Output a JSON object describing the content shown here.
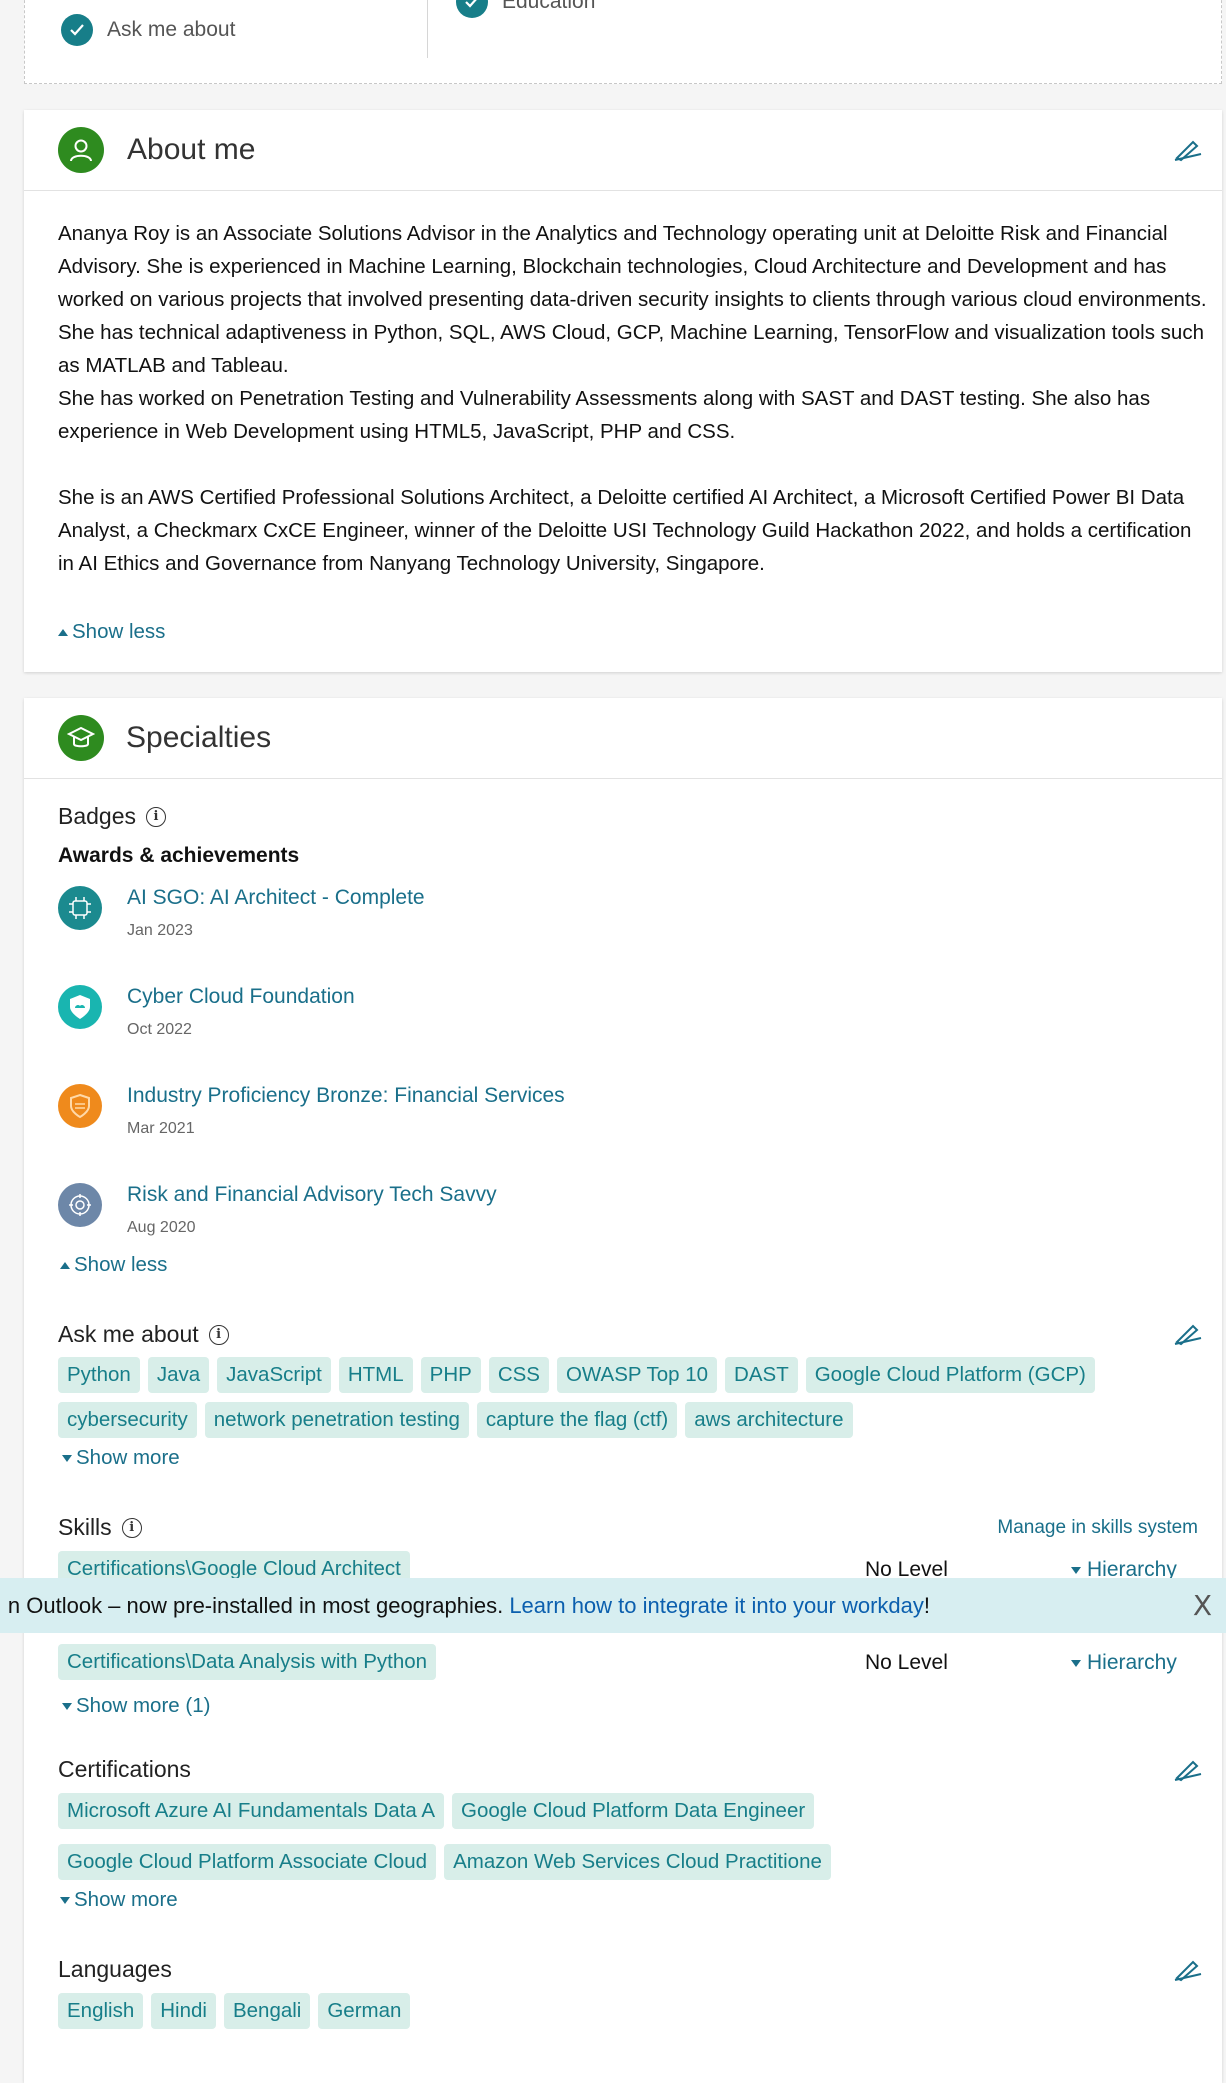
{
  "top_checks": {
    "item1": "Ask me about",
    "item2": "Education"
  },
  "about": {
    "title": "About me",
    "paragraphs": [
      "Ananya Roy is an Associate Solutions Advisor in the Analytics and Technology operating unit at Deloitte Risk and Financial Advisory. She is experienced in Machine Learning, Blockchain technologies, Cloud Architecture and Development and has worked on various projects that involved presenting data-driven security insights to clients through various cloud environments.",
      "She has technical adaptiveness in Python, SQL, AWS Cloud, GCP, Machine Learning, TensorFlow and visualization tools such as MATLAB and Tableau.",
      "She has worked on Penetration Testing and Vulnerability Assessments along with SAST and DAST testing. She also has experience in Web Development using HTML5, JavaScript, PHP and CSS.",
      "She is an AWS Certified Professional Solutions Architect, a Deloitte certified AI Architect, a Microsoft Certified Power BI Data Analyst, a Checkmarx CxCE Engineer, winner of the Deloitte USI Technology Guild Hackathon 2022, and holds a certification in AI Ethics and Governance from Nanyang Technology University, Singapore."
    ],
    "show_less": "Show less"
  },
  "specialties": {
    "title": "Specialties",
    "badges_label": "Badges",
    "awards_label": "Awards & achievements",
    "badges": [
      {
        "title": "AI SGO: AI Architect - Complete",
        "date": "Jan 2023",
        "color": "#1b8a8f"
      },
      {
        "title": "Cyber Cloud Foundation",
        "date": "Oct 2022",
        "color": "#19b5b0"
      },
      {
        "title": "Industry Proficiency Bronze: Financial Services",
        "date": "Mar 2021",
        "color": "#ef8a1c"
      },
      {
        "title": "Risk and Financial Advisory Tech Savvy",
        "date": "Aug 2020",
        "color": "#6d87a8"
      }
    ],
    "badges_show_less": "Show less",
    "ask_label": "Ask me about",
    "ask_tags": [
      "Python",
      "Java",
      "JavaScript",
      "HTML",
      "PHP",
      "CSS",
      "OWASP Top 10",
      "DAST",
      "Google Cloud Platform (GCP)",
      "cybersecurity",
      "network penetration testing",
      "capture the flag (ctf)",
      "aws architecture"
    ],
    "ask_show_more": "Show more",
    "skills_label": "Skills",
    "manage_link": "Manage in skills system",
    "skills": [
      {
        "name": "Certifications\\Google Cloud Architect",
        "level": "No Level",
        "hierarchy": "Hierarchy"
      },
      {
        "name": "Certifications\\Data Analysis with Python",
        "level": "No Level",
        "hierarchy": "Hierarchy"
      }
    ],
    "skills_show_more": "Show more (1)",
    "cert_label": "Certifications",
    "certs": [
      "Microsoft Azure AI Fundamentals Data A",
      "Google Cloud Platform Data Engineer",
      "Google Cloud Platform Associate Cloud",
      "Amazon Web Services Cloud Practitione"
    ],
    "cert_show_more": "Show more",
    "lang_label": "Languages",
    "languages": [
      "English",
      "Hindi",
      "Bengali",
      "German"
    ]
  },
  "banner": {
    "text": "n Outlook – now pre-installed in most geographies. ",
    "link": "Learn how to integrate it into your workday",
    "suffix": "!",
    "close": "X"
  },
  "colors": {
    "accent": "#177e89",
    "link": "#1a6f8a",
    "header_icon": "#2e8b1f",
    "tag_bg": "#d8eee9",
    "banner_bg": "#d7eef1"
  }
}
